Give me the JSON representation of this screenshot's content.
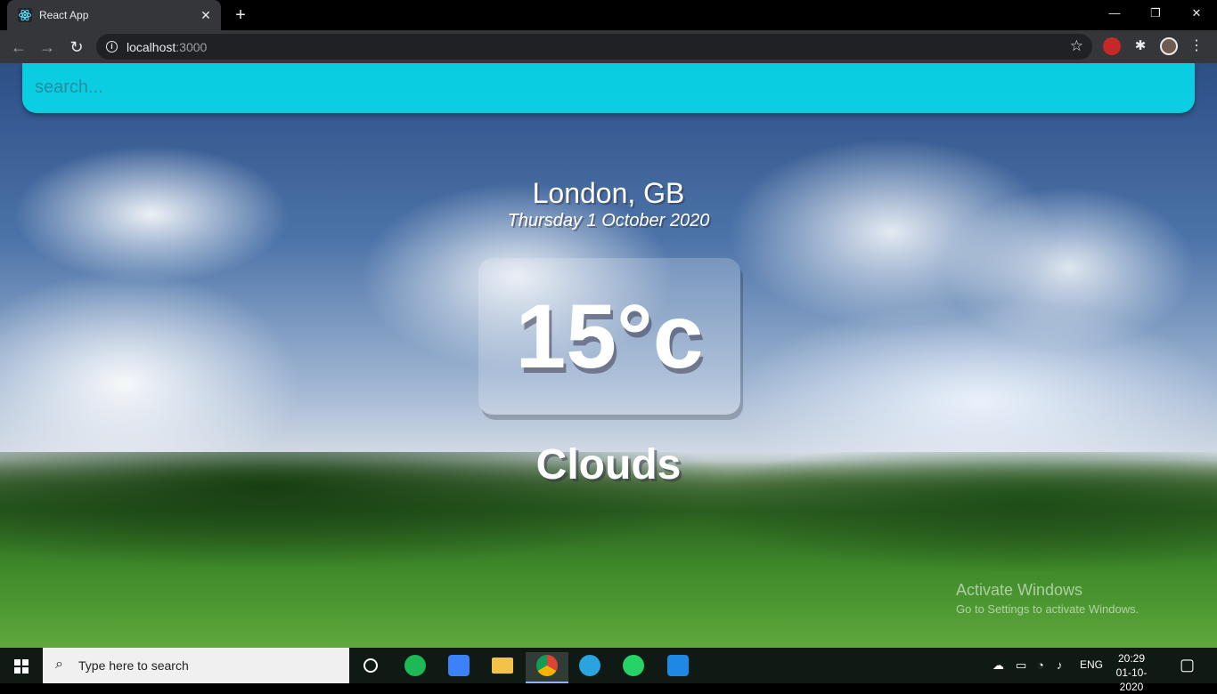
{
  "browser": {
    "tab_title": "React App",
    "tab_close": "✕",
    "new_tab": "+",
    "url_host": "localhost",
    "url_port": ":3000",
    "nav": {
      "back": "←",
      "forward": "→",
      "reload": "↻"
    },
    "window": {
      "minimize": "—",
      "maximize": "❐",
      "close": "✕"
    }
  },
  "weather_app": {
    "search_placeholder": "search...",
    "location": "London, GB",
    "date": "Thursday 1 October 2020",
    "temperature": "15°c",
    "condition": "Clouds"
  },
  "watermark": {
    "title": "Activate Windows",
    "subtitle": "Go to Settings to activate Windows."
  },
  "taskbar": {
    "search_placeholder": "Type here to search",
    "language": "ENG",
    "time": "20:29",
    "date": "01-10-2020",
    "apps": [
      "task-view",
      "spotify",
      "todo",
      "file-explorer",
      "chrome",
      "telegram",
      "whatsapp",
      "vscode"
    ],
    "colors": {
      "spotify": "#1db954",
      "todo": "#3b82f6",
      "file_explorer": "#f2c24b",
      "chrome": "#e5e5e5",
      "telegram": "#2aa3df",
      "whatsapp": "#25d366",
      "vscode": "#1e88e5"
    }
  }
}
